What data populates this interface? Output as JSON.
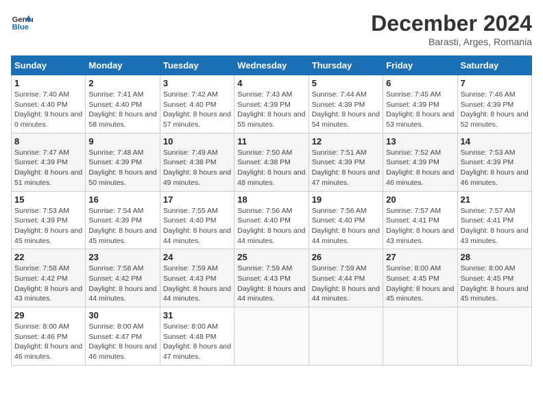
{
  "logo": {
    "line1": "General",
    "line2": "Blue"
  },
  "title": "December 2024",
  "subtitle": "Barasti, Arges, Romania",
  "days_header": [
    "Sunday",
    "Monday",
    "Tuesday",
    "Wednesday",
    "Thursday",
    "Friday",
    "Saturday"
  ],
  "weeks": [
    [
      {
        "day": "1",
        "sunrise": "7:40 AM",
        "sunset": "4:40 PM",
        "daylight": "9 hours and 0 minutes."
      },
      {
        "day": "2",
        "sunrise": "7:41 AM",
        "sunset": "4:40 PM",
        "daylight": "8 hours and 58 minutes."
      },
      {
        "day": "3",
        "sunrise": "7:42 AM",
        "sunset": "4:40 PM",
        "daylight": "8 hours and 57 minutes."
      },
      {
        "day": "4",
        "sunrise": "7:43 AM",
        "sunset": "4:39 PM",
        "daylight": "8 hours and 55 minutes."
      },
      {
        "day": "5",
        "sunrise": "7:44 AM",
        "sunset": "4:39 PM",
        "daylight": "8 hours and 54 minutes."
      },
      {
        "day": "6",
        "sunrise": "7:45 AM",
        "sunset": "4:39 PM",
        "daylight": "8 hours and 53 minutes."
      },
      {
        "day": "7",
        "sunrise": "7:46 AM",
        "sunset": "4:39 PM",
        "daylight": "8 hours and 52 minutes."
      }
    ],
    [
      {
        "day": "8",
        "sunrise": "7:47 AM",
        "sunset": "4:39 PM",
        "daylight": "8 hours and 51 minutes."
      },
      {
        "day": "9",
        "sunrise": "7:48 AM",
        "sunset": "4:39 PM",
        "daylight": "8 hours and 50 minutes."
      },
      {
        "day": "10",
        "sunrise": "7:49 AM",
        "sunset": "4:38 PM",
        "daylight": "8 hours and 49 minutes."
      },
      {
        "day": "11",
        "sunrise": "7:50 AM",
        "sunset": "4:38 PM",
        "daylight": "8 hours and 48 minutes."
      },
      {
        "day": "12",
        "sunrise": "7:51 AM",
        "sunset": "4:39 PM",
        "daylight": "8 hours and 47 minutes."
      },
      {
        "day": "13",
        "sunrise": "7:52 AM",
        "sunset": "4:39 PM",
        "daylight": "8 hours and 46 minutes."
      },
      {
        "day": "14",
        "sunrise": "7:53 AM",
        "sunset": "4:39 PM",
        "daylight": "8 hours and 46 minutes."
      }
    ],
    [
      {
        "day": "15",
        "sunrise": "7:53 AM",
        "sunset": "4:39 PM",
        "daylight": "8 hours and 45 minutes."
      },
      {
        "day": "16",
        "sunrise": "7:54 AM",
        "sunset": "4:39 PM",
        "daylight": "8 hours and 45 minutes."
      },
      {
        "day": "17",
        "sunrise": "7:55 AM",
        "sunset": "4:40 PM",
        "daylight": "8 hours and 44 minutes."
      },
      {
        "day": "18",
        "sunrise": "7:56 AM",
        "sunset": "4:40 PM",
        "daylight": "8 hours and 44 minutes."
      },
      {
        "day": "19",
        "sunrise": "7:56 AM",
        "sunset": "4:40 PM",
        "daylight": "8 hours and 44 minutes."
      },
      {
        "day": "20",
        "sunrise": "7:57 AM",
        "sunset": "4:41 PM",
        "daylight": "8 hours and 43 minutes."
      },
      {
        "day": "21",
        "sunrise": "7:57 AM",
        "sunset": "4:41 PM",
        "daylight": "8 hours and 43 minutes."
      }
    ],
    [
      {
        "day": "22",
        "sunrise": "7:58 AM",
        "sunset": "4:42 PM",
        "daylight": "8 hours and 43 minutes."
      },
      {
        "day": "23",
        "sunrise": "7:58 AM",
        "sunset": "4:42 PM",
        "daylight": "8 hours and 44 minutes."
      },
      {
        "day": "24",
        "sunrise": "7:59 AM",
        "sunset": "4:43 PM",
        "daylight": "8 hours and 44 minutes."
      },
      {
        "day": "25",
        "sunrise": "7:59 AM",
        "sunset": "4:43 PM",
        "daylight": "8 hours and 44 minutes."
      },
      {
        "day": "26",
        "sunrise": "7:59 AM",
        "sunset": "4:44 PM",
        "daylight": "8 hours and 44 minutes."
      },
      {
        "day": "27",
        "sunrise": "8:00 AM",
        "sunset": "4:45 PM",
        "daylight": "8 hours and 45 minutes."
      },
      {
        "day": "28",
        "sunrise": "8:00 AM",
        "sunset": "4:45 PM",
        "daylight": "8 hours and 45 minutes."
      }
    ],
    [
      {
        "day": "29",
        "sunrise": "8:00 AM",
        "sunset": "4:46 PM",
        "daylight": "8 hours and 46 minutes."
      },
      {
        "day": "30",
        "sunrise": "8:00 AM",
        "sunset": "4:47 PM",
        "daylight": "8 hours and 46 minutes."
      },
      {
        "day": "31",
        "sunrise": "8:00 AM",
        "sunset": "4:48 PM",
        "daylight": "8 hours and 47 minutes."
      },
      null,
      null,
      null,
      null
    ]
  ],
  "labels": {
    "sunrise": "Sunrise: ",
    "sunset": "Sunset: ",
    "daylight": "Daylight: "
  }
}
